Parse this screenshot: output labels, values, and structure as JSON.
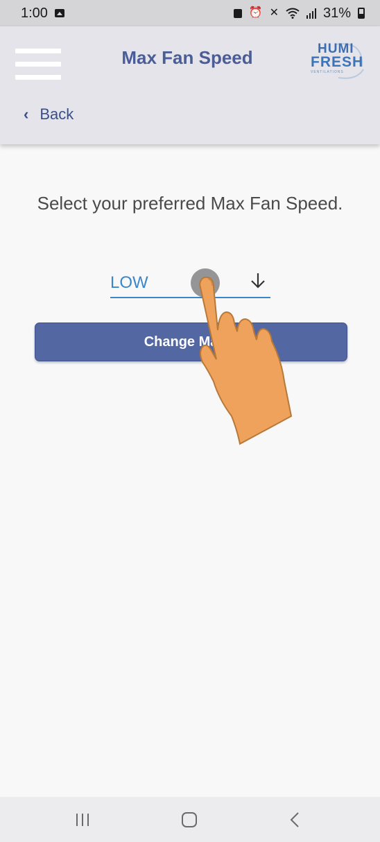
{
  "status_bar": {
    "time": "1:00",
    "battery_percent": "31%"
  },
  "header": {
    "title": "Max Fan Speed",
    "back_label": "Back",
    "logo": {
      "line1": "HUMI",
      "line2": "FRESH",
      "sub": "VENTILATIONS"
    }
  },
  "main": {
    "instruction": "Select your preferred Max Fan Speed.",
    "speed_select": {
      "selected_value": "LOW"
    },
    "change_button_label": "Change Max F"
  },
  "colors": {
    "title": "#4a5d96",
    "accent_blue": "#3b86c9",
    "button_bg": "#5367a3",
    "header_bg": "#e4e4ea"
  },
  "icons": [
    "image-icon",
    "lock-icon",
    "alarm-icon",
    "mute-icon",
    "wifi-icon",
    "signal-icon",
    "battery-icon",
    "menu-icon",
    "chevron-left-icon",
    "arrow-down-icon",
    "tap-hand-icon",
    "recent-apps-icon",
    "home-icon",
    "back-nav-icon"
  ]
}
